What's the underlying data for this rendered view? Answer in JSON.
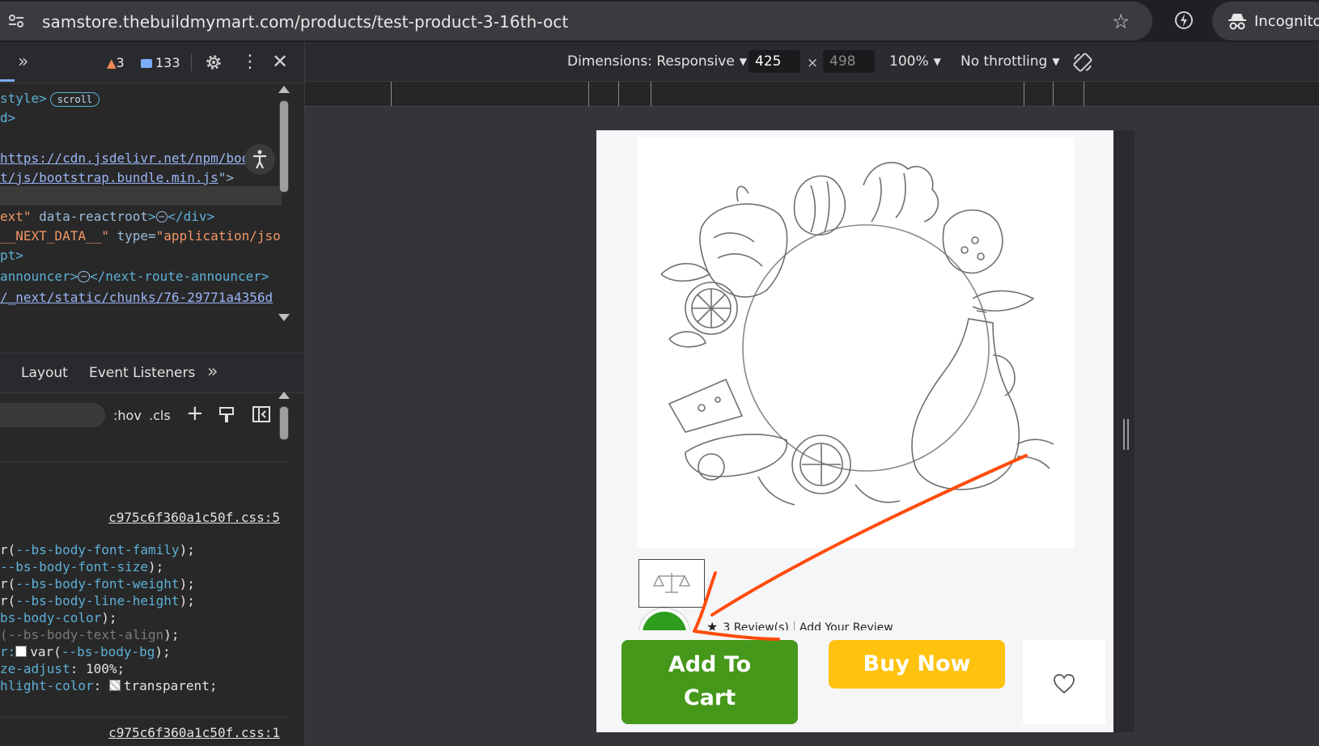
{
  "browser": {
    "url": "samstore.thebuildmymart.com/products/test-product-3-16th-oct",
    "profile_label": "Incognito",
    "icons": [
      "site-info-icon",
      "bookmark-star-icon",
      "performance-icon",
      "incognito-icon"
    ]
  },
  "devtools": {
    "toolbar": {
      "warnings_count": "3",
      "messages_count": "133"
    },
    "elements_lines": [
      {
        "parts": [
          {
            "c": "tag",
            "t": "style>"
          }
        ],
        "badge": "scroll"
      },
      {
        "parts": [
          {
            "c": "tag",
            "t": "d>"
          }
        ]
      },
      {
        "parts": [
          {
            "c": "link",
            "t": "https://cdn.jsdelivr.net/npm/bootst"
          }
        ]
      },
      {
        "parts": [
          {
            "c": "link",
            "t": "t/js/bootstrap.bundle.min.js"
          },
          {
            "c": "attr",
            "t": "\">"
          }
        ]
      },
      {
        "parts": [
          {
            "c": "val",
            "t": "ext\""
          },
          {
            "c": "attr",
            "t": " data-reactroot"
          },
          {
            "c": "tag",
            "t": ">"
          },
          {
            "c": "dots",
            "t": "⋯"
          },
          {
            "c": "tag",
            "t": "</div>"
          }
        ]
      },
      {
        "parts": [
          {
            "c": "val",
            "t": "__NEXT_DATA__\""
          },
          {
            "c": "attr",
            "t": " type="
          },
          {
            "c": "val",
            "t": "\"application/jso"
          }
        ]
      },
      {
        "parts": [
          {
            "c": "tag",
            "t": "pt>"
          }
        ]
      },
      {
        "parts": [
          {
            "c": "tag",
            "t": "announcer>"
          },
          {
            "c": "dots",
            "t": "⋯"
          },
          {
            "c": "tag",
            "t": "</next-route-announcer>"
          }
        ]
      },
      {
        "parts": [
          {
            "c": "link",
            "t": "/_next/static/chunks/76-29771a4356d"
          }
        ]
      }
    ],
    "sub_tabs": [
      "Layout",
      "Event Listeners"
    ],
    "filter": {
      "hov": ":hov",
      "cls": ".cls"
    },
    "styles": {
      "source1": "c975c6f360a1c50f.css:5",
      "source2": "c975c6f360a1c50f.css:1",
      "lines": [
        {
          "parts": [
            {
              "c": "",
              "t": "r("
            },
            {
              "c": "prop",
              "t": "--bs-body-font-family"
            },
            {
              "c": "",
              "t": ");"
            }
          ]
        },
        {
          "parts": [
            {
              "c": "prop",
              "t": "--bs-body-font-size"
            },
            {
              "c": "",
              "t": ");"
            }
          ]
        },
        {
          "parts": [
            {
              "c": "",
              "t": "r("
            },
            {
              "c": "prop",
              "t": "--bs-body-font-weight"
            },
            {
              "c": "",
              "t": ");"
            }
          ]
        },
        {
          "parts": [
            {
              "c": "",
              "t": "r("
            },
            {
              "c": "prop",
              "t": "--bs-body-line-height"
            },
            {
              "c": "",
              "t": ");"
            }
          ]
        },
        {
          "parts": [
            {
              "c": "prop",
              "t": "bs-body-color"
            },
            {
              "c": "",
              "t": ");"
            }
          ]
        },
        {
          "parts": [
            {
              "c": "dim",
              "t": "(--bs-body-text-align"
            },
            {
              "c": "",
              "t": ");"
            }
          ]
        },
        {
          "parts": [
            {
              "c": "prop",
              "t": "r:"
            },
            {
              "c": "swatch",
              "t": ""
            },
            {
              "c": "",
              "t": "var("
            },
            {
              "c": "prop",
              "t": "--bs-body-bg"
            },
            {
              "c": "",
              "t": ");"
            }
          ]
        },
        {
          "parts": [
            {
              "c": "prop",
              "t": "ze-adjust"
            },
            {
              "c": "",
              "t": ": 100%;"
            }
          ]
        },
        {
          "parts": [
            {
              "c": "prop",
              "t": "hlight-color"
            },
            {
              "c": "",
              "t": ": "
            },
            {
              "c": "swatch-tr",
              "t": ""
            },
            {
              "c": "",
              "t": "transparent;"
            }
          ]
        }
      ]
    }
  },
  "device_toolbar": {
    "dimensions_label": "Dimensions: Responsive",
    "width": "425",
    "height": "498",
    "zoom": "100%",
    "throttling": "No throttling"
  },
  "page": {
    "review_text": "3 Review(s)",
    "add_review": "Add Your Review",
    "add_to_cart_line1": "Add To",
    "add_to_cart_line2": "Cart",
    "buy_now": "Buy Now"
  },
  "colors": {
    "add_to_cart_bg": "#45981a",
    "buy_now_bg": "#ffc20e",
    "annotation_arrow": "#ff4c0c"
  }
}
